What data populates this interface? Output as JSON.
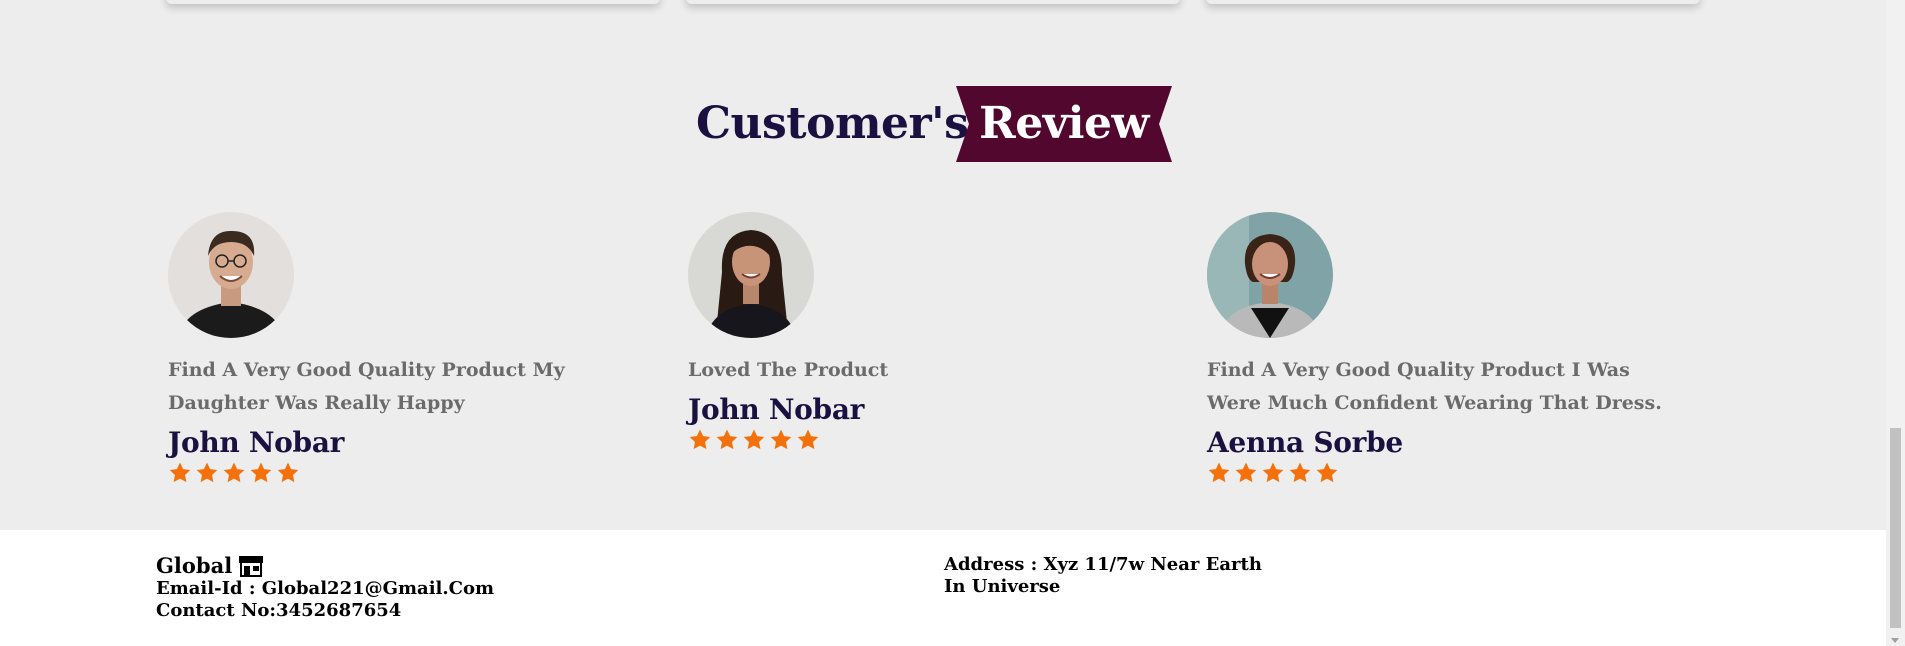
{
  "section": {
    "title_left": "Customer's",
    "title_right": "Review"
  },
  "reviews": [
    {
      "text": "Find A Very Good Quality Product My Daughter Was Really Happy",
      "name": "John Nobar",
      "rating": 5
    },
    {
      "text": "Loved The Product",
      "name": "John Nobar",
      "rating": 5
    },
    {
      "text": "Find A Very Good Quality Product I Was Were Much Confident Wearing That Dress.",
      "name": "Aenna Sorbe",
      "rating": 5
    }
  ],
  "footer": {
    "brand": "Global",
    "brand_icon": "store-icon",
    "email": "Email-Id : Global221@Gmail.Com",
    "contact": "Contact No:3452687654",
    "address": "Address : Xyz 11/7w Near Earth In Universe"
  },
  "colors": {
    "title_dark": "#1a1140",
    "ribbon": "#52072f",
    "star": "#f4700a",
    "review_text": "#6b6b6b"
  }
}
